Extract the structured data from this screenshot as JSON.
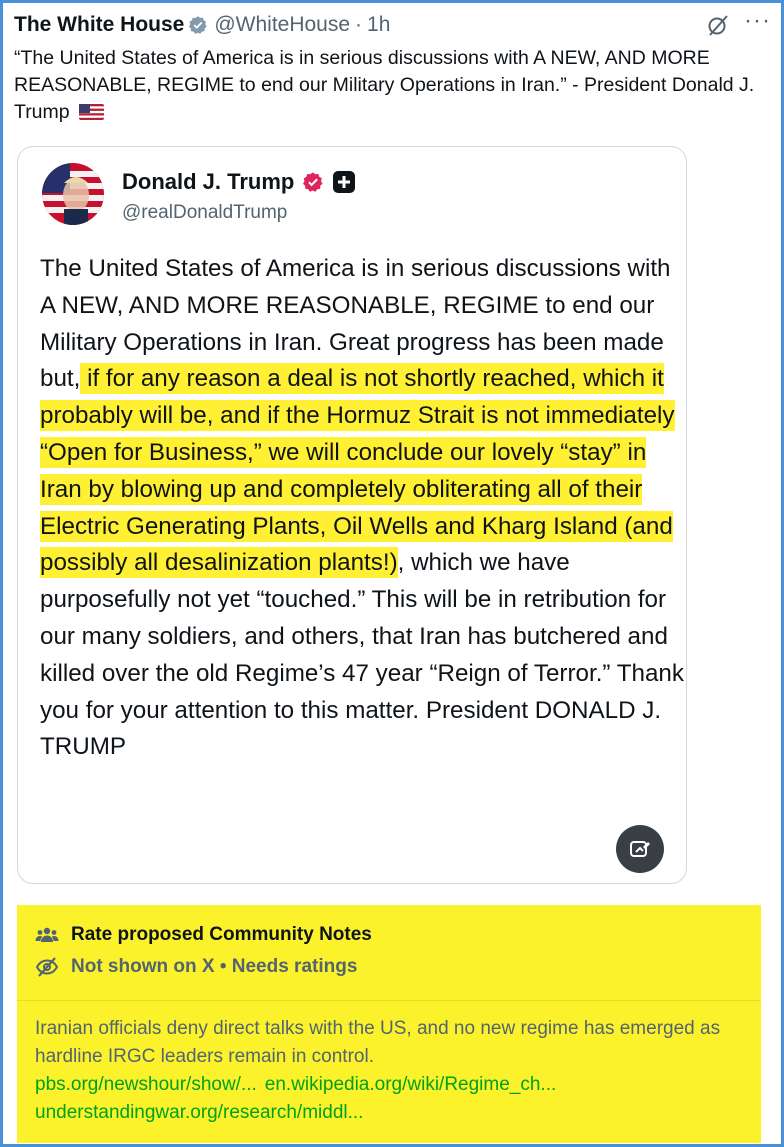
{
  "header": {
    "author": "The White House",
    "handle": "@WhiteHouse",
    "separator": "·",
    "time": "1h",
    "more": "···"
  },
  "tweet": {
    "text": "“The United States of America is in serious discussions with A NEW, AND MORE REASONABLE, REGIME to end our Military Operations in Iran.” - President Donald J. Trump"
  },
  "quote": {
    "name": "Donald J. Trump",
    "handle": "@realDonaldTrump",
    "body": {
      "p1": "The United States of America is in serious discussions with A NEW, AND MORE REASONABLE, REGIME to end our Military Operations in Iran. Great progress has been made but,",
      "h1": " if for any reason a deal is not shortly reached, which it probably will be",
      "h2": ", and if the Hormuz Strait is not immediately “Open for Business,” we will conclude our lovely “stay” in Iran by blowing up and completely obliterating all of their Electric Generating Plants, Oil Wells and Kharg Island (and possibly all desalinization plants!)",
      "p2": ", which we have purposefully not yet “touched.” This will be in retribution for our many soldiers, and others, that Iran has butchered and killed over the old Regime’s 47 year “Reign of Terror.” Thank you for your attention to this matter. President DONALD J. TRUMP"
    }
  },
  "community_notes": {
    "title": "Rate proposed Community Notes",
    "status": "Not shown on X • Needs ratings",
    "note": "Iranian officials deny direct talks with the US, and no new regime has emerged as hardline IRGC leaders remain in control.",
    "links": [
      "pbs.org/newshour/show/...",
      "en.wikipedia.org/wiki/Regime_ch...",
      "understandingwar.org/research/middl..."
    ]
  },
  "colors": {
    "highlight": "#fff033",
    "notes_bg": "#fbf22c",
    "link": "#00a11a",
    "verified_gold": "#e0245e"
  }
}
